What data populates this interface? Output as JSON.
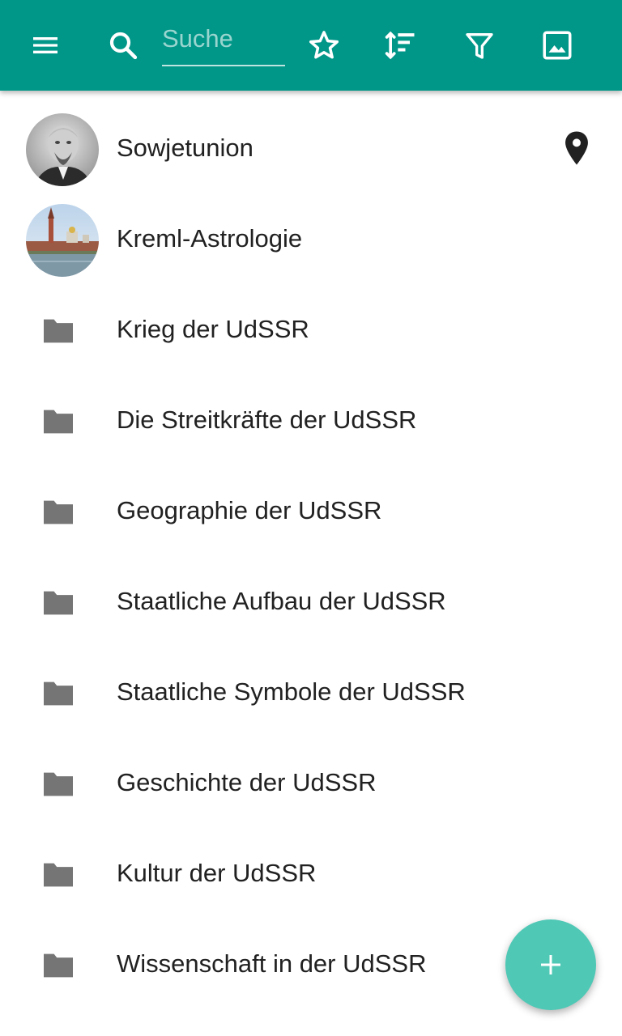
{
  "toolbar": {
    "menu_icon": "menu-icon",
    "search_icon": "search-icon",
    "search_placeholder": "Suche",
    "search_value": "",
    "favorite_icon": "star-outline-icon",
    "sort_icon": "sort-icon",
    "filter_icon": "filter-icon",
    "image_icon": "image-icon",
    "color": "#009688"
  },
  "items": [
    {
      "label": "Sowjetunion",
      "lead": "avatar-portrait",
      "trail": "location-pin-icon"
    },
    {
      "label": "Kreml-Astrologie",
      "lead": "avatar-kremlin"
    },
    {
      "label": "Krieg der UdSSR",
      "lead": "folder-icon"
    },
    {
      "label": "Die Streitkräfte der UdSSR",
      "lead": "folder-icon"
    },
    {
      "label": "Geographie der UdSSR",
      "lead": "folder-icon"
    },
    {
      "label": "Staatliche Aufbau der UdSSR",
      "lead": "folder-icon"
    },
    {
      "label": "Staatliche Symbole der UdSSR",
      "lead": "folder-icon"
    },
    {
      "label": "Geschichte der UdSSR",
      "lead": "folder-icon"
    },
    {
      "label": "Kultur der UdSSR",
      "lead": "folder-icon"
    },
    {
      "label": "Wissenschaft in der UdSSR",
      "lead": "folder-icon"
    }
  ],
  "fab": {
    "icon": "plus-icon",
    "color": "#4fc8b6"
  }
}
